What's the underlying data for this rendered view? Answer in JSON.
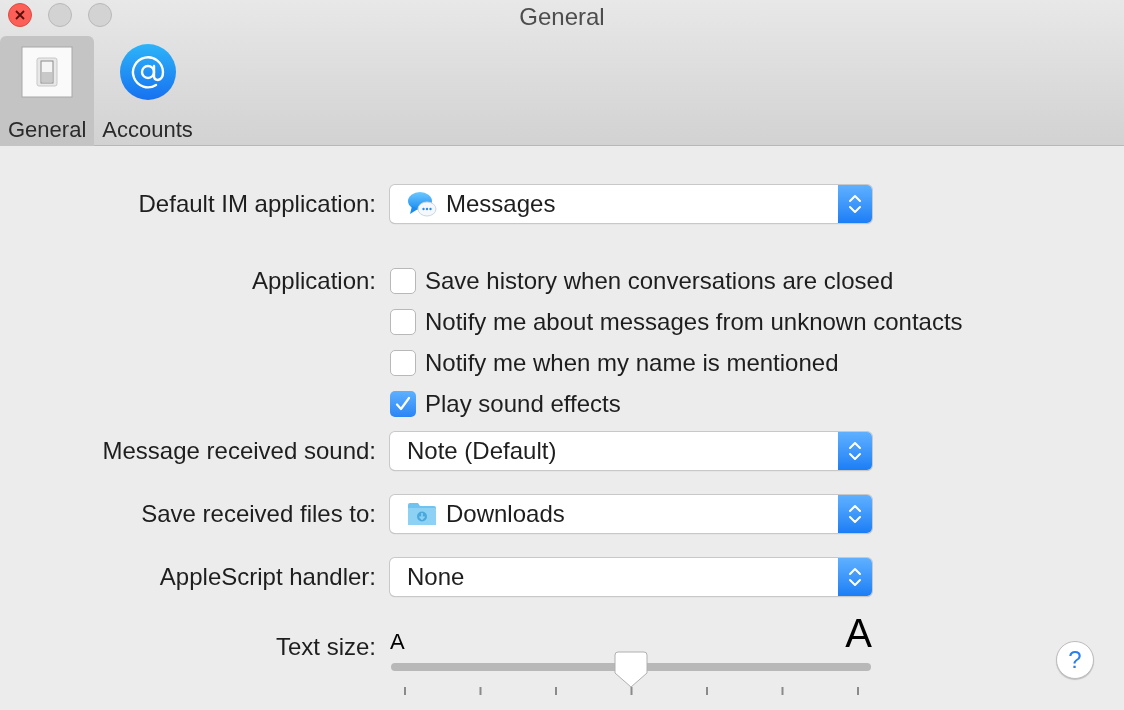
{
  "window": {
    "title": "General"
  },
  "toolbar": {
    "tabs": [
      {
        "kind": "general",
        "label": "General",
        "selected": true
      },
      {
        "kind": "accounts",
        "label": "Accounts",
        "selected": false
      }
    ]
  },
  "rows": [
    {
      "kind": "app",
      "label": "Default IM application:",
      "value": "Messages"
    },
    {
      "kind": "checkboxes",
      "label": "Application:",
      "options": [
        {
          "label": "Save history when conversations are closed",
          "checked": false
        },
        {
          "label": "Notify me about messages from unknown contacts",
          "checked": false
        },
        {
          "label": "Notify me when my name is mentioned",
          "checked": false
        },
        {
          "label": "Play sound effects",
          "checked": true
        }
      ]
    },
    {
      "kind": "popup",
      "label": "Message received sound:",
      "value": "Note (Default)"
    },
    {
      "kind": "folder",
      "label": "Save received files to:",
      "value": "Downloads"
    },
    {
      "kind": "popup",
      "label": "AppleScript handler:",
      "value": "None"
    },
    {
      "kind": "slider",
      "label": "Text size:",
      "min_label": "A",
      "max_label": "A",
      "level": 0.5
    }
  ],
  "help_button": {
    "label": "?"
  }
}
